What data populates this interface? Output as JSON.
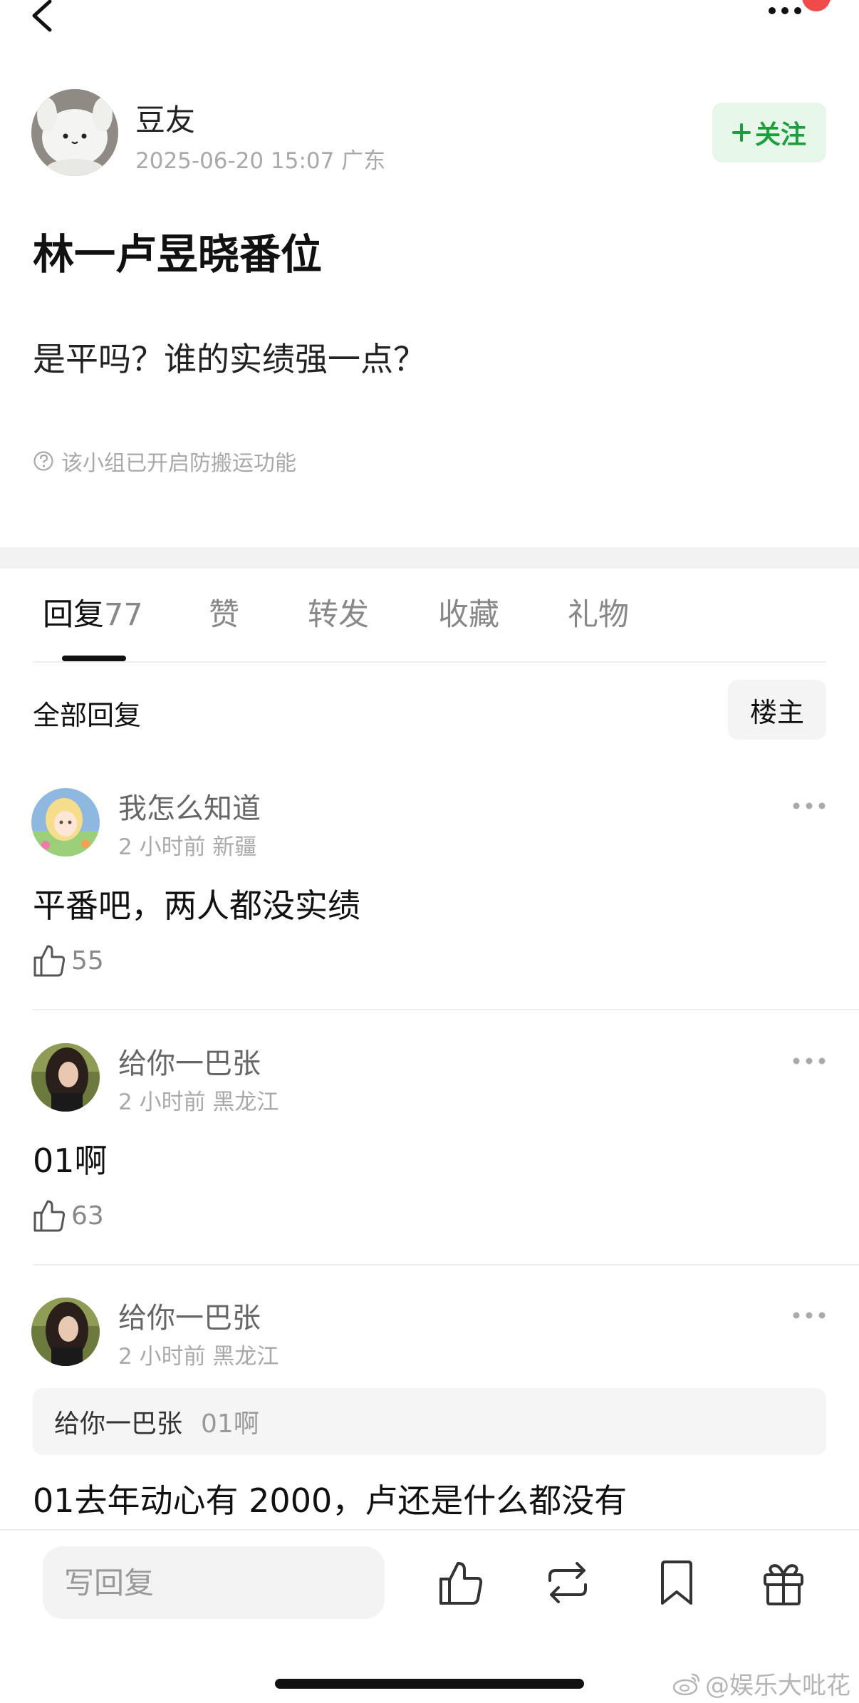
{
  "post": {
    "author": "豆友",
    "meta": "2025-06-20 15:07  广东",
    "follow_label": "关注",
    "title": "林一卢昱晓番位",
    "body": "是平吗？谁的实绩强一点？",
    "notice": "该小组已开启防搬运功能"
  },
  "tabs": [
    {
      "label": "回复",
      "count": "77"
    },
    {
      "label": "赞"
    },
    {
      "label": "转发"
    },
    {
      "label": "收藏"
    },
    {
      "label": "礼物"
    }
  ],
  "filter": {
    "all_label": "全部回复",
    "op_label": "楼主"
  },
  "comments": [
    {
      "name": "我怎么知道",
      "meta": "2 小时前  新疆",
      "text": "平番吧，两人都没实绩",
      "likes": "55"
    },
    {
      "name": "给你一巴张",
      "meta": "2 小时前  黑龙江",
      "text": "01啊",
      "likes": "63"
    },
    {
      "name": "给你一巴张",
      "meta": "2 小时前  黑龙江",
      "quote_name": "给你一巴张",
      "quote_text": "01啊",
      "text": "01去年动心有 2000，卢还是什么都没有"
    }
  ],
  "bottom": {
    "reply_placeholder": "写回复"
  },
  "watermark": "@娱乐大吡花",
  "colors": {
    "accent_green": "#1a9f3d",
    "follow_bg": "#e6f7ea",
    "notification_red": "#f04a4a"
  }
}
